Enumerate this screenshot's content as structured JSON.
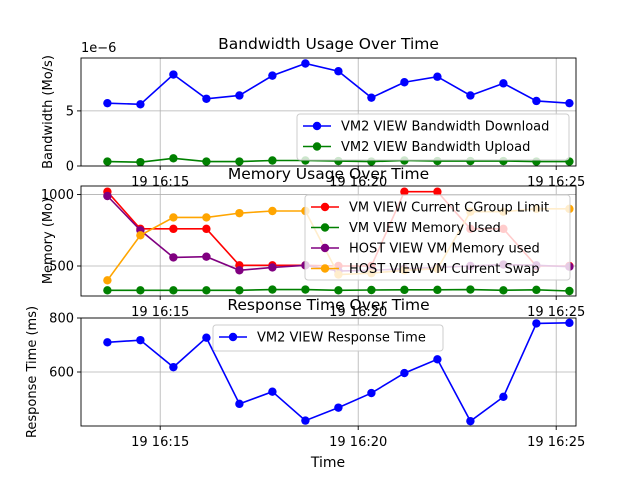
{
  "figure": {
    "xlabel": "Time"
  },
  "chart_data": [
    {
      "type": "line",
      "title": "Bandwidth Usage Over Time",
      "xlabel": "",
      "ylabel": "Bandwidth (Mo/s)",
      "y_offset_label": "1e−6",
      "ylim": [
        0,
        9.8
      ],
      "yticks": [
        0,
        5
      ],
      "xticks": [
        "19 16:15",
        "19 16:20",
        "19 16:25"
      ],
      "grid": true,
      "legend_position": "lower-right",
      "x": [
        "16:13:40",
        "16:14:30",
        "16:15:20",
        "16:16:10",
        "16:17:00",
        "16:17:50",
        "16:18:40",
        "16:19:30",
        "16:20:20",
        "16:21:10",
        "16:22:00",
        "16:22:50",
        "16:23:40",
        "16:24:30",
        "16:25:20"
      ],
      "series": [
        {
          "name": "VM2 VIEW Bandwidth Download",
          "color": "#0000ff",
          "values": [
            5.7,
            5.6,
            8.3,
            6.1,
            6.4,
            8.2,
            9.3,
            8.6,
            6.2,
            7.6,
            8.1,
            6.4,
            7.5,
            5.9,
            5.7
          ]
        },
        {
          "name": "VM2 VIEW Bandwidth Upload",
          "color": "#008000",
          "values": [
            0.4,
            0.35,
            0.7,
            0.4,
            0.4,
            0.5,
            0.5,
            0.45,
            0.4,
            0.5,
            0.45,
            0.45,
            0.45,
            0.4,
            0.4
          ]
        }
      ]
    },
    {
      "type": "line",
      "title": "Memory Usage Over Time",
      "xlabel": "",
      "ylabel": "Memory (Mo)",
      "ylim": [
        290,
        1060
      ],
      "yticks": [
        500,
        1000
      ],
      "xticks": [
        "19 16:15",
        "19 16:20",
        "19 16:25"
      ],
      "grid": true,
      "legend_position": "top-right",
      "x": [
        "16:13:40",
        "16:14:30",
        "16:15:20",
        "16:16:10",
        "16:17:00",
        "16:17:50",
        "16:18:40",
        "16:19:30",
        "16:20:20",
        "16:21:10",
        "16:22:00",
        "16:22:50",
        "16:23:40",
        "16:24:30",
        "16:25:20"
      ],
      "series": [
        {
          "name": "VM VIEW Current CGroup Limit",
          "color": "#ff0000",
          "values": [
            1020,
            760,
            760,
            760,
            505,
            505,
            505,
            500,
            500,
            1020,
            1020,
            760,
            760,
            500,
            500
          ]
        },
        {
          "name": "VM VIEW Memory Used",
          "color": "#008000",
          "values": [
            330,
            330,
            330,
            330,
            330,
            335,
            335,
            330,
            332,
            333,
            333,
            335,
            330,
            333,
            325
          ]
        },
        {
          "name": "HOST VIEW VM Memory used",
          "color": "#800080",
          "values": [
            990,
            750,
            560,
            565,
            470,
            490,
            505,
            465,
            470,
            480,
            490,
            500,
            510,
            505,
            495
          ]
        },
        {
          "name": "HOST VIEW VM Current Swap",
          "color": "#ffa500",
          "values": [
            400,
            715,
            840,
            840,
            870,
            885,
            885,
            440,
            450,
            470,
            480,
            880,
            880,
            900,
            900
          ]
        }
      ]
    },
    {
      "type": "line",
      "title": "Response Time Over Time",
      "xlabel": "Time",
      "ylabel": "Response Time (ms)",
      "ylim": [
        400,
        800
      ],
      "yticks": [
        600,
        800
      ],
      "xticks": [
        "19 16:15",
        "19 16:20",
        "19 16:25"
      ],
      "grid": true,
      "legend_position": "top-center",
      "x": [
        "16:13:40",
        "16:14:30",
        "16:15:20",
        "16:16:10",
        "16:17:00",
        "16:17:50",
        "16:18:40",
        "16:19:30",
        "16:20:20",
        "16:21:10",
        "16:22:00",
        "16:22:50",
        "16:23:40",
        "16:24:30",
        "16:25:20"
      ],
      "series": [
        {
          "name": "VM2 VIEW Response Time",
          "color": "#0000ff",
          "values": [
            710,
            718,
            618,
            727,
            482,
            527,
            420,
            468,
            522,
            596,
            647,
            418,
            508,
            780,
            782
          ]
        }
      ]
    }
  ]
}
